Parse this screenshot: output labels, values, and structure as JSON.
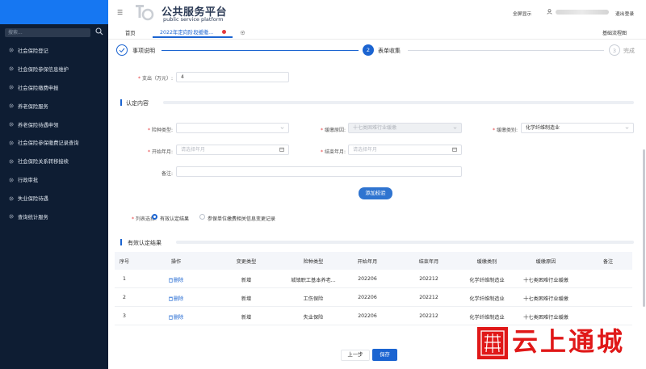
{
  "header": {
    "title_cn": "公共服务平台",
    "title_en": "public service platform",
    "fullscreen": "全屏显示",
    "logout": "退出登录"
  },
  "sidebar": {
    "search_placeholder": "搜索...",
    "items": [
      {
        "label": "社会保险登记"
      },
      {
        "label": "社会保险参保信息维护"
      },
      {
        "label": "社会保险缴费申报"
      },
      {
        "label": "养老保险服务"
      },
      {
        "label": "养老保险待遇申领"
      },
      {
        "label": "社会保险参保缴费记录查询"
      },
      {
        "label": "社会保险关系转移接续"
      },
      {
        "label": "行政审批"
      },
      {
        "label": "失业保险待遇"
      },
      {
        "label": "查询统计服务"
      }
    ]
  },
  "tabs": {
    "home": "首页",
    "active": "2022年定向阶段缓缴...",
    "right": "基础流程图"
  },
  "steps": [
    {
      "label": "事项说明",
      "status": "done"
    },
    {
      "number": "2",
      "label": "表单收集",
      "status": "active"
    },
    {
      "number": "3",
      "label": "完成",
      "status": "pending"
    }
  ],
  "form": {
    "expense_label": "支出（万元）:",
    "expense_value": "4",
    "section_title": "认定内容",
    "insurance_type_label": "险种类型:",
    "insurance_type_value": "",
    "defer_reason_label": "缓缴原因:",
    "defer_reason_value": "十七类困难行业缓缴",
    "defer_category_label": "缓缴类别:",
    "defer_category_value": "化学纤维制造业",
    "start_label": "开始年月:",
    "start_placeholder": "请选择年月",
    "end_label": "结束年月:",
    "end_placeholder": "请选择年月",
    "remark_label": "备注:",
    "add_check_button": "添加校验",
    "list_select_label": "列表选择:",
    "radio_valid": "有效认定结果",
    "radio_changes": "参保单位缴费相关信息变更记录"
  },
  "result": {
    "section_title": "有效认定结果",
    "columns": [
      "序号",
      "操作",
      "变更类型",
      "险种类型",
      "开始年月",
      "结束年月",
      "缓缴类别",
      "缓缴原因",
      "备注"
    ],
    "rows": [
      [
        "1",
        "删除",
        "新增",
        "城镇职工基本养老...",
        "202206",
        "202212",
        "化学纤维制造业",
        "十七类困难行业缓缴",
        ""
      ],
      [
        "2",
        "删除",
        "新增",
        "工伤保险",
        "202206",
        "202212",
        "化学纤维制造业",
        "十七类困难行业缓缴",
        ""
      ],
      [
        "3",
        "删除",
        "新增",
        "失业保险",
        "202206",
        "202212",
        "化学纤维制造业",
        "十七类困难行业缓缴",
        ""
      ]
    ]
  },
  "footer": {
    "prev_button": "上一步",
    "save_button": "保存"
  },
  "watermark": {
    "text": "云上通城",
    "color": "#e01818"
  },
  "colors": {
    "primary": "#1b64d1",
    "sidebar_bg": "#0e1d33",
    "brand_bar": "#1677f2"
  }
}
